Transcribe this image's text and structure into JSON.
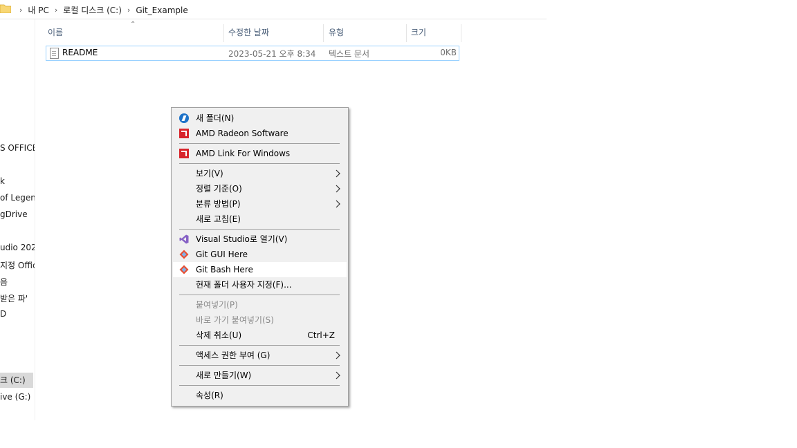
{
  "breadcrumb": {
    "items": [
      "내 PC",
      "로컬 디스크 (C:)",
      "Git_Example"
    ]
  },
  "nav": {
    "items": [
      "S OFFICE",
      "k",
      "of Legend",
      "gDrive",
      "udio 202",
      "지정 Offic",
      "음",
      " 받은 파'",
      "D",
      "크 (C:)",
      "ive (G:)"
    ]
  },
  "columns": {
    "name": "이름",
    "date": "수정한 날짜",
    "type": "유형",
    "size": "크기"
  },
  "files": [
    {
      "name": "README",
      "date": "2023-05-21 오후 8:34",
      "type": "텍스트 문서",
      "size": "0KB"
    }
  ],
  "menu": {
    "new_folder": "새 폴더(N)",
    "amd_radeon": "AMD Radeon Software",
    "amd_link": "AMD Link For Windows",
    "view": "보기(V)",
    "sort": "정렬 기준(O)",
    "group": "분류 방법(P)",
    "refresh": "새로 고침(E)",
    "vs_open": "Visual Studio로 열기(V)",
    "git_gui": "Git GUI Here",
    "git_bash": "Git Bash Here",
    "customize": "현재 폴더 사용자 지정(F)...",
    "paste": "붙여넣기(P)",
    "paste_shortcut": "바로 가기 붙여넣기(S)",
    "undo_delete": "삭제 취소(U)",
    "undo_shortcut": "Ctrl+Z",
    "give_access": "액세스 권한 부여 (G)",
    "new": "새로 만들기(W)",
    "properties": "속성(R)"
  },
  "icons": {
    "folder": "folder-icon",
    "file": "text-file-icon",
    "new_folder": "new-folder-icon",
    "amd": "amd-icon",
    "visual_studio": "visual-studio-icon",
    "git": "git-icon",
    "submenu": "chevron-right-icon"
  },
  "colors": {
    "amd_red": "#d8242b",
    "vs_purple": "#8661c5",
    "selection_border": "#99d1ff",
    "menu_bg": "#f0f0f0"
  }
}
